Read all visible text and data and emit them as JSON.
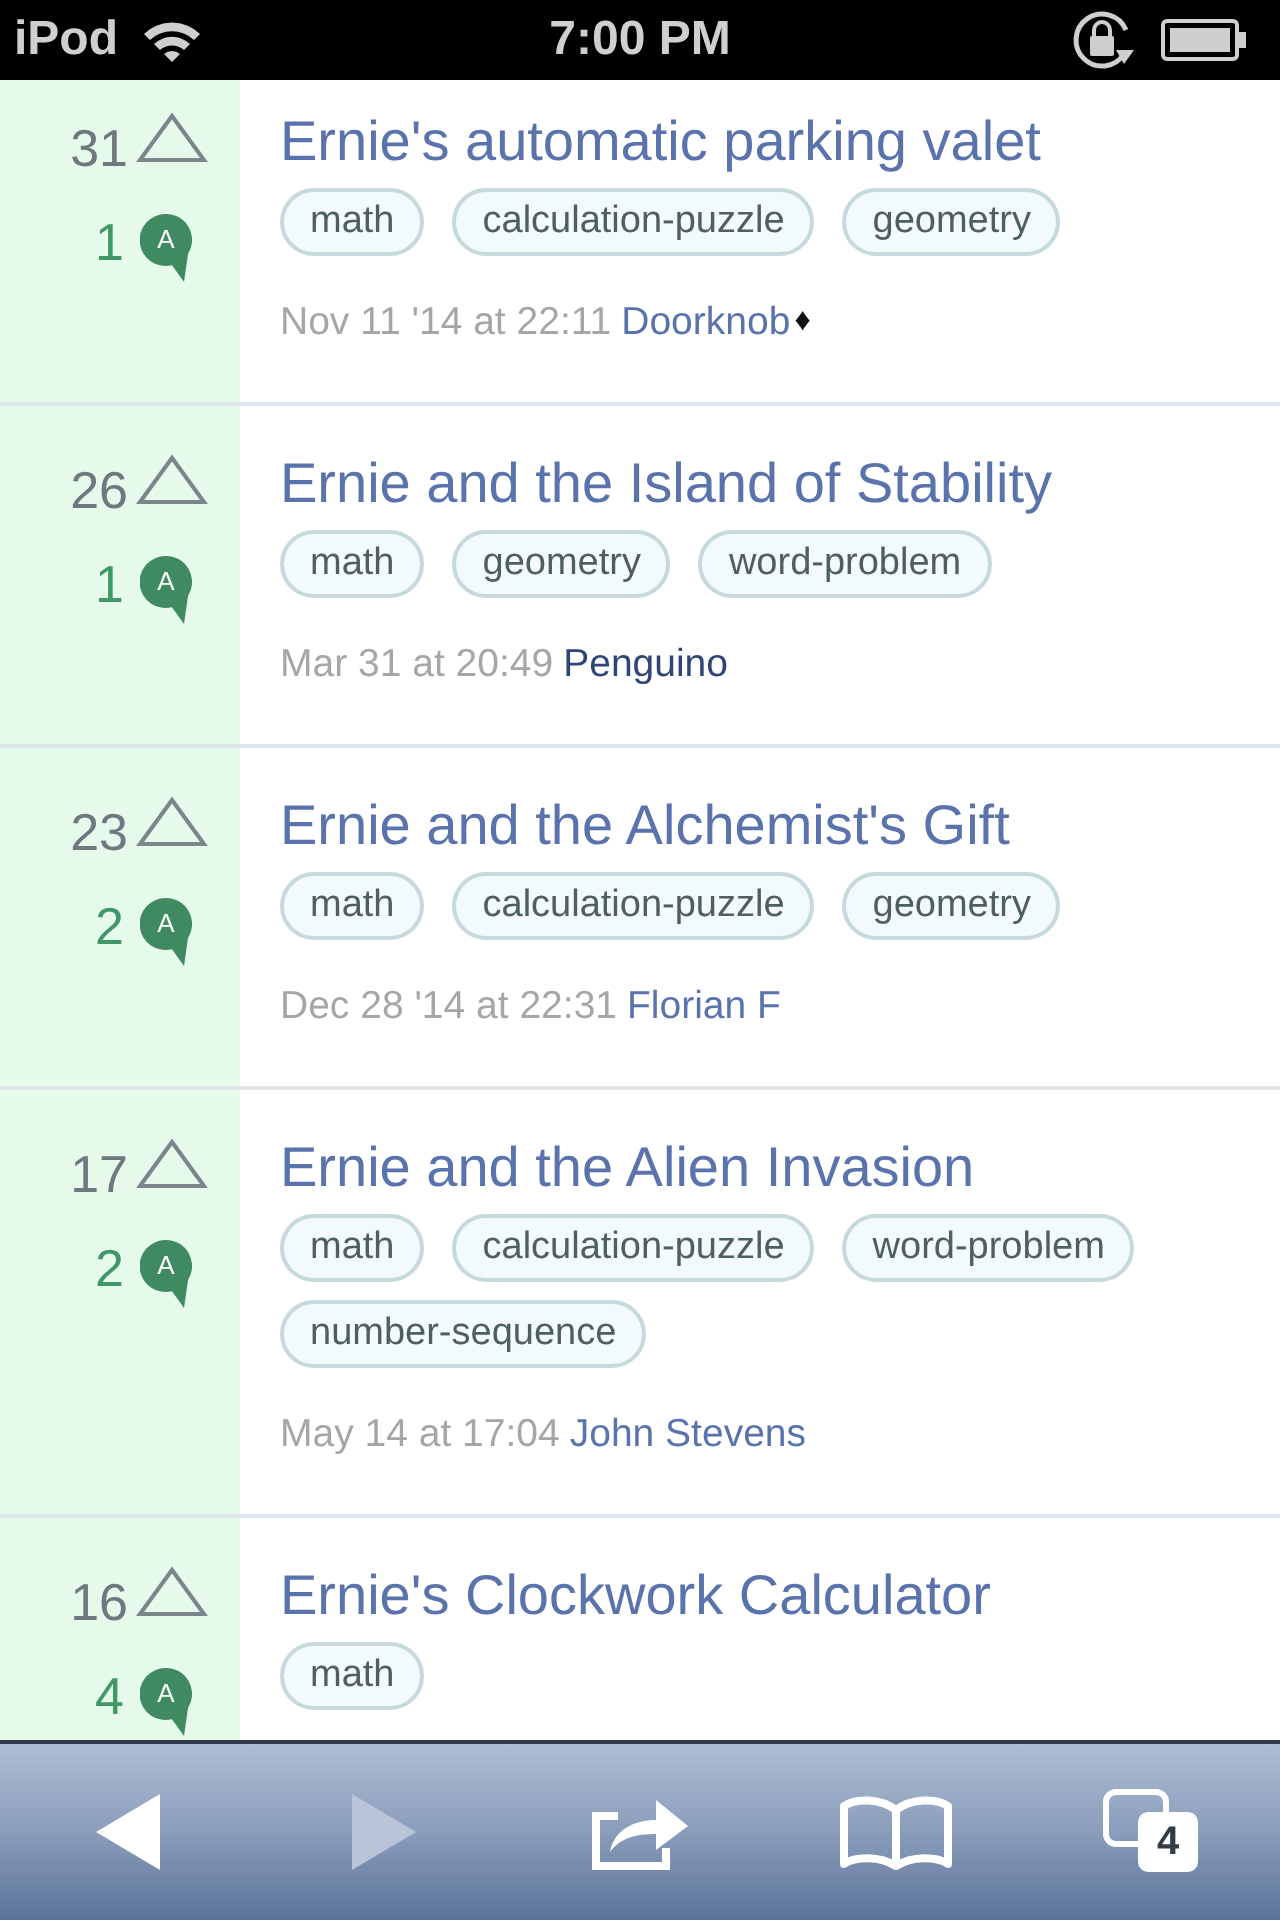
{
  "status_bar": {
    "carrier": "iPod",
    "time": "7:00 PM"
  },
  "questions": [
    {
      "votes": "31",
      "answers": "1",
      "answer_badge": "A",
      "title": "Ernie's automatic parking valet",
      "tags": [
        "math",
        "calculation-puzzle",
        "geometry"
      ],
      "asked": "Nov 11 '14 at 22:11",
      "author": {
        "name": "Doorknob",
        "mark": "♦",
        "color": "#5a73ad"
      }
    },
    {
      "votes": "26",
      "answers": "1",
      "answer_badge": "A",
      "title": "Ernie and the Island of Stability",
      "tags": [
        "math",
        "geometry",
        "word-problem"
      ],
      "asked": "Mar 31 at 20:49",
      "author": {
        "name": "Penguino",
        "color": "#2f4576"
      }
    },
    {
      "votes": "23",
      "answers": "2",
      "answer_badge": "A",
      "title": "Ernie and the Alchemist's Gift",
      "tags": [
        "math",
        "calculation-puzzle",
        "geometry"
      ],
      "asked": "Dec 28 '14 at 22:31",
      "author": {
        "name": "Florian F",
        "color": "#5a73ad"
      }
    },
    {
      "votes": "17",
      "answers": "2",
      "answer_badge": "A",
      "title": "Ernie and the Alien Invasion",
      "tags": [
        "math",
        "calculation-puzzle",
        "word-problem",
        "number-sequence"
      ],
      "asked": "May 14 at 17:04",
      "author": {
        "name": "John Stevens",
        "color": "#5a73ad"
      }
    },
    {
      "votes": "16",
      "answers": "4",
      "answer_badge": "A",
      "title": "Ernie's Clockwork Calculator",
      "tags": [
        "math"
      ]
    }
  ],
  "toolbar": {
    "buttons": [
      {
        "kind": "back",
        "disabled": false
      },
      {
        "kind": "forward",
        "disabled": true
      },
      {
        "kind": "share",
        "disabled": false
      },
      {
        "kind": "bookmarks",
        "disabled": false
      },
      {
        "kind": "tabs",
        "disabled": false,
        "count": "4"
      }
    ]
  }
}
